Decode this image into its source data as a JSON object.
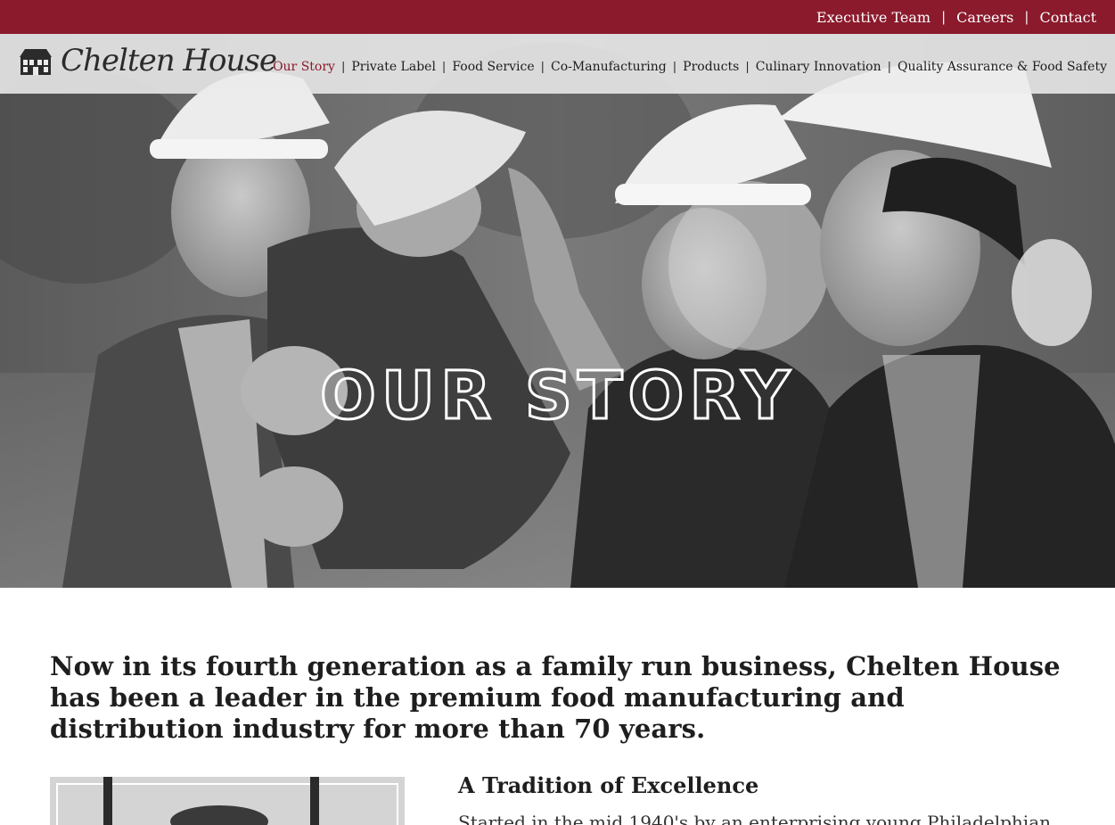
{
  "utility_nav": {
    "items": [
      {
        "label": "Executive Team"
      },
      {
        "label": "Careers"
      },
      {
        "label": "Contact"
      }
    ],
    "separator": "|"
  },
  "brand": {
    "name": "Chelten House",
    "logo_icon": "house-icon",
    "color": "#8a1a2c"
  },
  "main_nav": {
    "items": [
      {
        "label": "Our Story",
        "active": true
      },
      {
        "label": "Private Label",
        "active": false
      },
      {
        "label": "Food Service",
        "active": false
      },
      {
        "label": "Co-Manufacturing",
        "active": false
      },
      {
        "label": "Products",
        "active": false
      },
      {
        "label": "Culinary Innovation",
        "active": false
      },
      {
        "label": "Quality Assurance & Food Safety",
        "active": false
      }
    ],
    "separator": "|"
  },
  "hero": {
    "title": "OUR STORY",
    "image": "family-photo"
  },
  "content": {
    "intro": "Now in its fourth generation as a family run business, Chelten House has been a leader in the premium food manufacturing and distribution industry for more than 70 years.",
    "section_heading": "A Tradition of Excellence",
    "section_body": "Started in the mid 1940's by an enterprising young Philadelphian"
  }
}
